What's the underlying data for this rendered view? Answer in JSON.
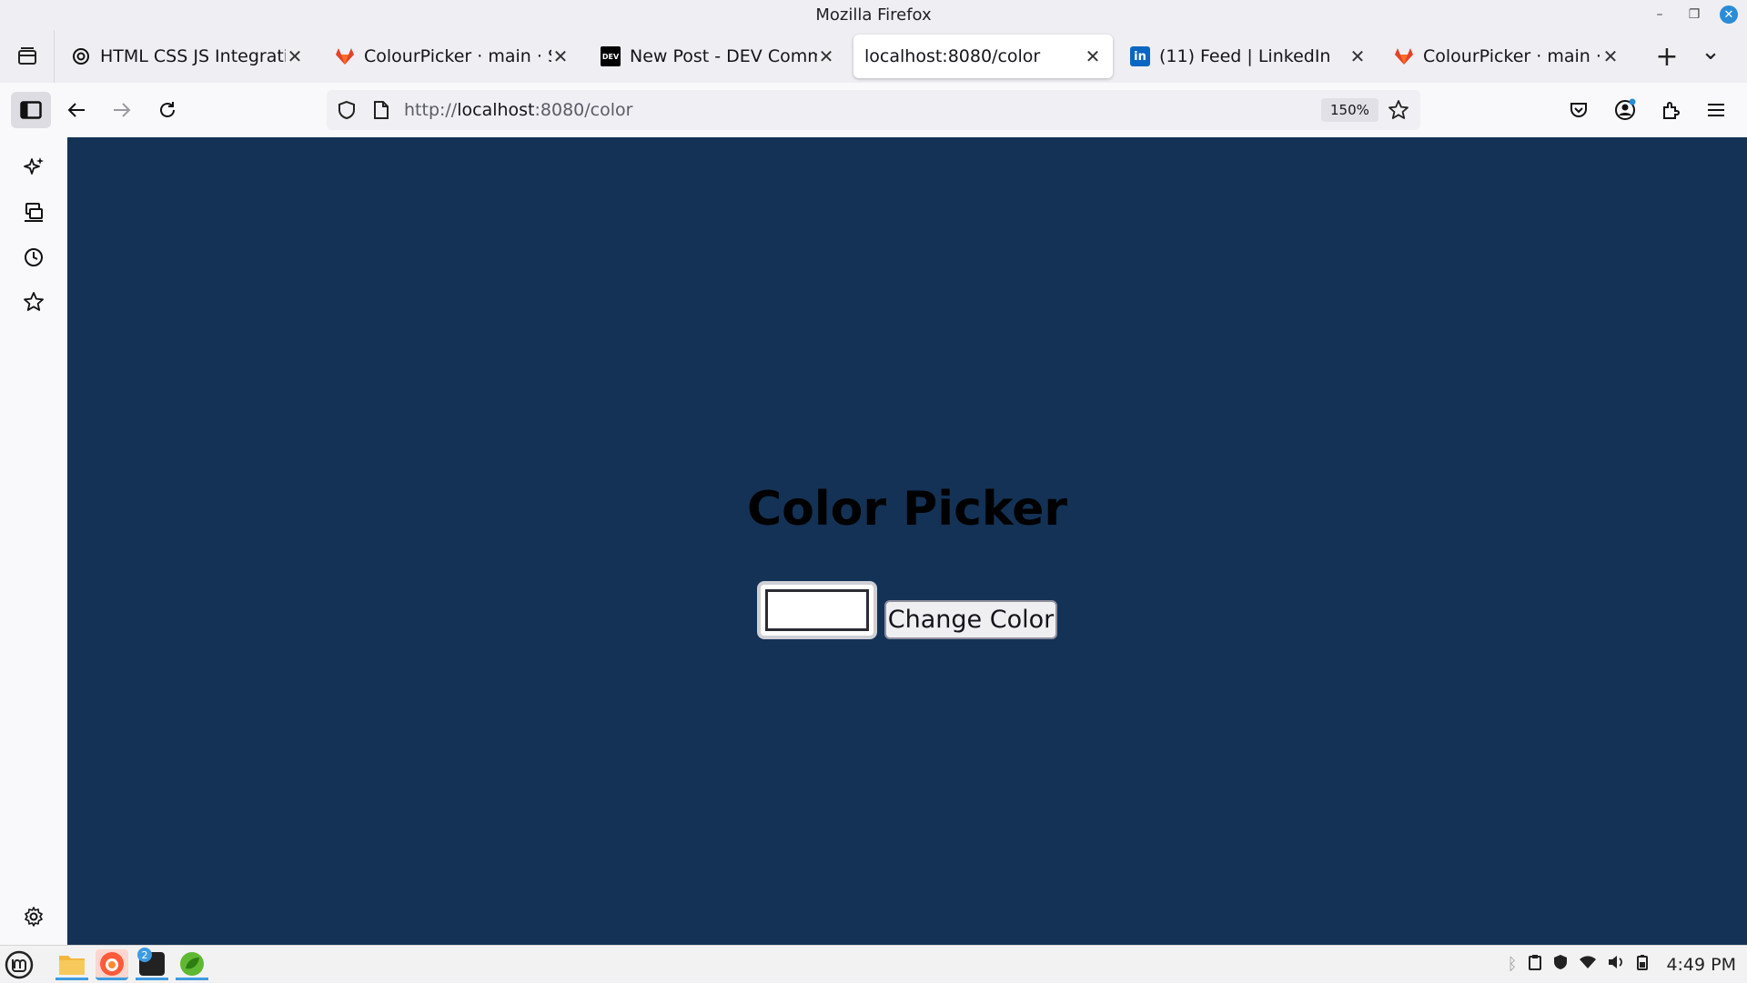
{
  "window": {
    "title": "Mozilla Firefox",
    "controls": {
      "minimize": "–",
      "restore": "❐",
      "close": "✕"
    }
  },
  "tabs": [
    {
      "label": "HTML CSS JS Integration",
      "icon": "openai-icon",
      "active": false
    },
    {
      "label": "ColourPicker · main · Sudh",
      "icon": "gitlab-icon",
      "active": false
    },
    {
      "label": "New Post - DEV Communi",
      "icon": "dev-icon",
      "active": false
    },
    {
      "label": "localhost:8080/color",
      "icon": "none",
      "active": true
    },
    {
      "label": "(11) Feed | LinkedIn",
      "icon": "linkedin-icon",
      "active": false
    },
    {
      "label": "ColourPicker · main · Sudh",
      "icon": "gitlab-icon",
      "active": false
    }
  ],
  "tab_close_glyph": "✕",
  "new_tab_glyph": "+",
  "tab_list_glyph": "⌄",
  "dev_favicon_text": "DEV",
  "linkedin_favicon_text": "in",
  "navbar": {
    "url_prefix": "http://",
    "url_host": "localhost",
    "url_suffix": ":8080/color",
    "zoom": "150%"
  },
  "page": {
    "title": "Color Picker",
    "input_value": "",
    "button_label": "Change Color",
    "background_color": "#133255"
  },
  "taskbar": {
    "clock": "4:49 PM",
    "terminal_badge": "2"
  },
  "colors": {
    "accent": "#2a8cd6",
    "page_bg": "#133255"
  }
}
